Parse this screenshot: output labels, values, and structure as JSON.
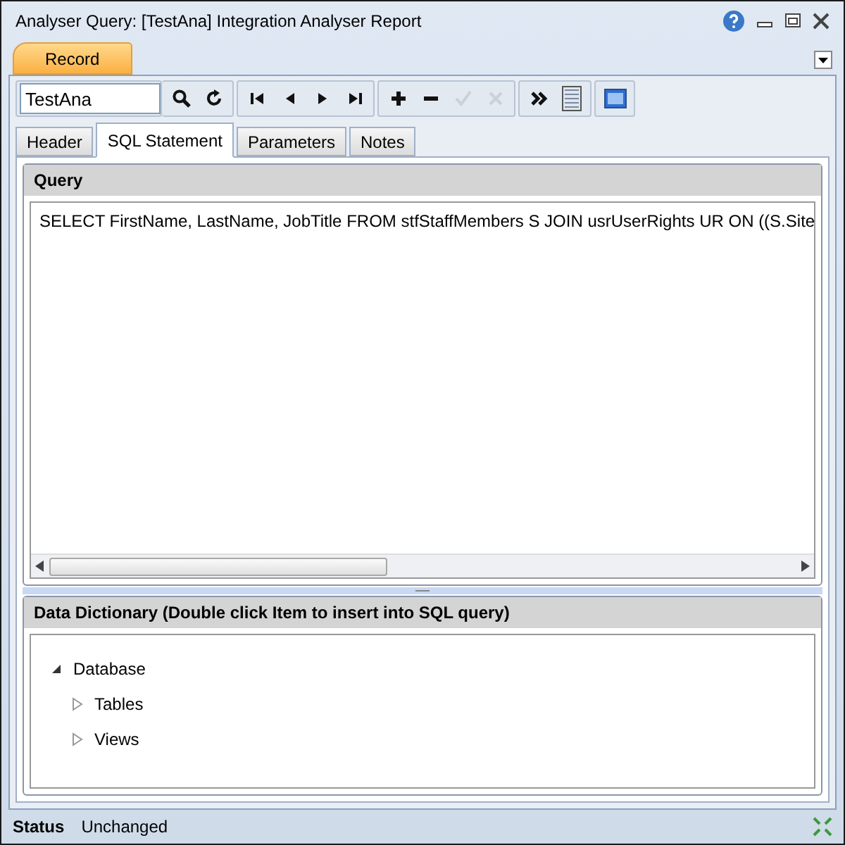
{
  "window": {
    "title": "Analyser Query: [TestAna] Integration Analyser Report"
  },
  "ribbon_tabs": [
    {
      "label": "Record",
      "selected": true
    }
  ],
  "toolbar": {
    "search_value": "TestAna",
    "groups": [
      [
        {
          "kind": "search",
          "disabled": false
        },
        {
          "kind": "refresh",
          "disabled": false
        }
      ],
      [
        {
          "kind": "first",
          "disabled": false
        },
        {
          "kind": "prev",
          "disabled": false
        },
        {
          "kind": "next",
          "disabled": false
        },
        {
          "kind": "last",
          "disabled": false
        }
      ],
      [
        {
          "kind": "add",
          "disabled": false
        },
        {
          "kind": "remove",
          "disabled": false
        },
        {
          "kind": "accept",
          "disabled": true
        },
        {
          "kind": "cancel",
          "disabled": true
        }
      ],
      [
        {
          "kind": "more",
          "disabled": false
        },
        {
          "kind": "list",
          "disabled": false
        }
      ],
      [
        {
          "kind": "form",
          "disabled": false
        }
      ]
    ]
  },
  "tabs": [
    {
      "label": "Header",
      "selected": false
    },
    {
      "label": "SQL Statement",
      "selected": true
    },
    {
      "label": "Parameters",
      "selected": false
    },
    {
      "label": "Notes",
      "selected": false
    }
  ],
  "query": {
    "title": "Query",
    "text": "SELECT FirstName, LastName, JobTitle FROM stfStaffMembers S JOIN usrUserRights UR ON ((S.Site"
  },
  "dictionary": {
    "title": "Data Dictionary (Double click Item to insert into SQL query)",
    "tree": [
      {
        "label": "Database",
        "expanded": true,
        "children": [
          {
            "label": "Tables",
            "expanded": false
          },
          {
            "label": "Views",
            "expanded": false
          }
        ]
      }
    ]
  },
  "status_bar": {
    "label": "Status",
    "value": "Unchanged"
  }
}
